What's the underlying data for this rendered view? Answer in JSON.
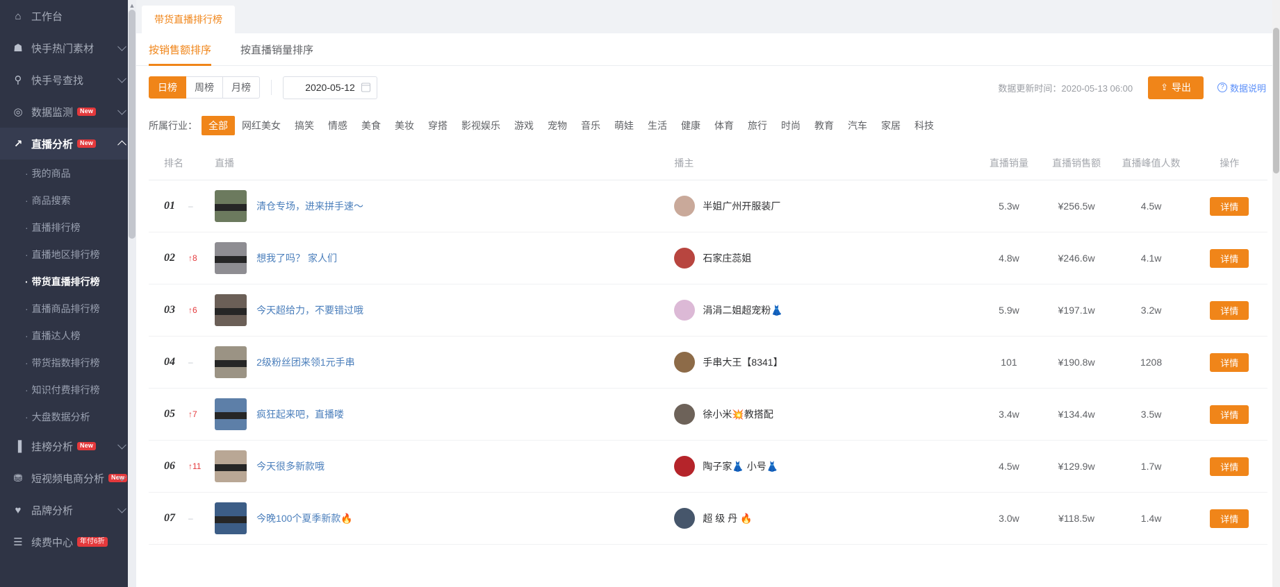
{
  "sidebar": {
    "groups": [
      {
        "icon": "home-icon",
        "glyph": "⌂",
        "label": "工作台",
        "badge": "",
        "chevron": "none",
        "active": false
      },
      {
        "icon": "fire-icon",
        "glyph": "☗",
        "label": "快手热门素材",
        "badge": "",
        "chevron": "down",
        "active": false
      },
      {
        "icon": "search-icon",
        "glyph": "⚲",
        "label": "快手号查找",
        "badge": "",
        "chevron": "down",
        "active": false
      },
      {
        "icon": "monitor-icon",
        "glyph": "◎",
        "label": "数据监测",
        "badge": "New",
        "chevron": "down",
        "active": false
      },
      {
        "icon": "chart-line-icon",
        "glyph": "↗",
        "label": "直播分析",
        "badge": "New",
        "chevron": "up",
        "active": true
      }
    ],
    "sub_items": [
      {
        "label": "我的商品",
        "active": false
      },
      {
        "label": "商品搜索",
        "active": false
      },
      {
        "label": "直播排行榜",
        "active": false
      },
      {
        "label": "直播地区排行榜",
        "active": false
      },
      {
        "label": "带货直播排行榜",
        "active": true
      },
      {
        "label": "直播商品排行榜",
        "active": false
      },
      {
        "label": "直播达人榜",
        "active": false
      },
      {
        "label": "带货指数排行榜",
        "active": false
      },
      {
        "label": "知识付费排行榜",
        "active": false
      },
      {
        "label": "大盘数据分析",
        "active": false
      }
    ],
    "groups_bottom": [
      {
        "icon": "bar-chart-icon",
        "glyph": "▐",
        "label": "挂榜分析",
        "badge": "New",
        "chevron": "down"
      },
      {
        "icon": "video-shop-icon",
        "glyph": "⛃",
        "label": "短视频电商分析",
        "badge": "New",
        "chevron": "down"
      },
      {
        "icon": "heart-icon",
        "glyph": "♥",
        "label": "品牌分析",
        "badge": "",
        "chevron": "down"
      },
      {
        "icon": "renew-icon",
        "glyph": "☰",
        "label": "续费中心",
        "badge_sale": "年付6折",
        "chevron": "none"
      }
    ]
  },
  "page_tab": {
    "label": "带货直播排行榜"
  },
  "subtabs": [
    {
      "label": "按销售额排序",
      "active": true
    },
    {
      "label": "按直播销量排序",
      "active": false
    }
  ],
  "toolbar": {
    "period_buttons": [
      {
        "label": "日榜",
        "active": true
      },
      {
        "label": "周榜",
        "active": false
      },
      {
        "label": "月榜",
        "active": false
      }
    ],
    "date_value": "2020-05-12",
    "update_time": "数据更新时间：2020-05-13 06:00",
    "export_label": "导出",
    "export_icon": "upload-icon",
    "help_label": "数据说明",
    "help_icon": "question-circle-icon"
  },
  "industry": {
    "label": "所属行业：",
    "items": [
      {
        "label": "全部",
        "active": true
      },
      {
        "label": "网红美女",
        "active": false
      },
      {
        "label": "搞笑",
        "active": false
      },
      {
        "label": "情感",
        "active": false
      },
      {
        "label": "美食",
        "active": false
      },
      {
        "label": "美妆",
        "active": false
      },
      {
        "label": "穿搭",
        "active": false
      },
      {
        "label": "影视娱乐",
        "active": false
      },
      {
        "label": "游戏",
        "active": false
      },
      {
        "label": "宠物",
        "active": false
      },
      {
        "label": "音乐",
        "active": false
      },
      {
        "label": "萌娃",
        "active": false
      },
      {
        "label": "生活",
        "active": false
      },
      {
        "label": "健康",
        "active": false
      },
      {
        "label": "体育",
        "active": false
      },
      {
        "label": "旅行",
        "active": false
      },
      {
        "label": "时尚",
        "active": false
      },
      {
        "label": "教育",
        "active": false
      },
      {
        "label": "汽车",
        "active": false
      },
      {
        "label": "家居",
        "active": false
      },
      {
        "label": "科技",
        "active": false
      }
    ]
  },
  "table": {
    "headers": {
      "rank": "排名",
      "live": "直播",
      "host": "播主",
      "sales_volume": "直播销量",
      "sales_amount": "直播销售额",
      "peak_viewers": "直播峰值人数",
      "action": "操作"
    },
    "detail_label": "详情",
    "rows": [
      {
        "rank": "01",
        "delta": "–",
        "delta_up": false,
        "title": "清仓专场，进来拼手速～",
        "host": "半姐广州开服装厂",
        "sales_volume": "5.3w",
        "sales_amount": "¥256.5w",
        "peak_viewers": "4.5w",
        "thumb_color": "#6c7a5e",
        "avatar_color": "#c9a99a"
      },
      {
        "rank": "02",
        "delta": "↑8",
        "delta_up": true,
        "title": "想我了吗？ 家人们",
        "host": "石家庄蕊姐",
        "sales_volume": "4.8w",
        "sales_amount": "¥246.6w",
        "peak_viewers": "4.1w",
        "thumb_color": "#8e8d92",
        "avatar_color": "#b8453f"
      },
      {
        "rank": "03",
        "delta": "↑6",
        "delta_up": true,
        "title": "今天超给力，不要错过哦",
        "host": "涓涓二姐超宠粉👗",
        "sales_volume": "5.9w",
        "sales_amount": "¥197.1w",
        "peak_viewers": "3.2w",
        "thumb_color": "#6b5f57",
        "avatar_color": "#dcb9d6"
      },
      {
        "rank": "04",
        "delta": "–",
        "delta_up": false,
        "title": "2级粉丝团来领1元手串",
        "host": "手串大王【8341】",
        "sales_volume": "101",
        "sales_amount": "¥190.8w",
        "peak_viewers": "1208",
        "thumb_color": "#9b9384",
        "avatar_color": "#8d6b48"
      },
      {
        "rank": "05",
        "delta": "↑7",
        "delta_up": true,
        "title": "疯狂起来吧，直播喽",
        "host": "徐小米💥教搭配",
        "sales_volume": "3.4w",
        "sales_amount": "¥134.4w",
        "peak_viewers": "3.5w",
        "thumb_color": "#5d7fa8",
        "avatar_color": "#6d6259"
      },
      {
        "rank": "06",
        "delta": "↑11",
        "delta_up": true,
        "title": "今天很多新款哦",
        "host": "陶子家👗 小号👗",
        "sales_volume": "4.5w",
        "sales_amount": "¥129.9w",
        "peak_viewers": "1.7w",
        "thumb_color": "#b9a795",
        "avatar_color": "#b5242a"
      },
      {
        "rank": "07",
        "delta": "–",
        "delta_up": false,
        "title": "今晚100个夏季新款🔥",
        "host": "超 级 丹 🔥",
        "sales_volume": "3.0w",
        "sales_amount": "¥118.5w",
        "peak_viewers": "1.4w",
        "thumb_color": "#3c5d86",
        "avatar_color": "#46566b"
      }
    ]
  }
}
